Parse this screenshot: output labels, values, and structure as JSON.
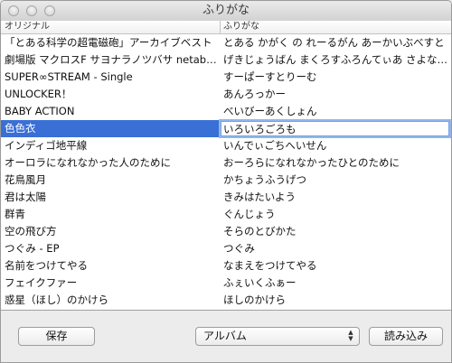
{
  "window": {
    "title": "ふりがな"
  },
  "table": {
    "headers": {
      "original": "オリジナル",
      "furigana": "ふりがな"
    },
    "rows": [
      {
        "original": "「とある科学の超電磁砲」アーカイブベスト",
        "furigana": "とある かがく の れーるがん あーかいぶべすと"
      },
      {
        "original": "劇場版 マクロスF サヨナラノツバサ netabare album",
        "furigana": "げきじょうばん まくろすふろんてぃあ さよならのつばさ"
      },
      {
        "original": "SUPER∞STREAM - Single",
        "furigana": "すーぱーすとりーむ"
      },
      {
        "original": "UNLOCKER！",
        "furigana": "あんろっかー"
      },
      {
        "original": "BABY ACTION",
        "furigana": "べいびーあくしょん"
      },
      {
        "original": "色色衣",
        "furigana": "いろいろごろも",
        "selected": true
      },
      {
        "original": "インディゴ地平線",
        "furigana": "いんでぃごちへいせん"
      },
      {
        "original": "オーロラになれなかった人のために",
        "furigana": "おーろらになれなかったひとのために"
      },
      {
        "original": "花鳥風月",
        "furigana": "かちょうふうげつ"
      },
      {
        "original": "君は太陽",
        "furigana": "きみはたいよう"
      },
      {
        "original": "群青",
        "furigana": "ぐんじょう"
      },
      {
        "original": "空の飛び方",
        "furigana": "そらのとびかた"
      },
      {
        "original": "つぐみ - EP",
        "furigana": "つぐみ"
      },
      {
        "original": "名前をつけてやる",
        "furigana": "なまえをつけてやる"
      },
      {
        "original": "フェイクファー",
        "furigana": "ふぇいくふぁー"
      },
      {
        "original": "惑星（ほし）のかけら",
        "furigana": "ほしのかけら"
      }
    ]
  },
  "footer": {
    "save_label": "保存",
    "category_selected": "アルバム",
    "load_label": "読み込み"
  }
}
